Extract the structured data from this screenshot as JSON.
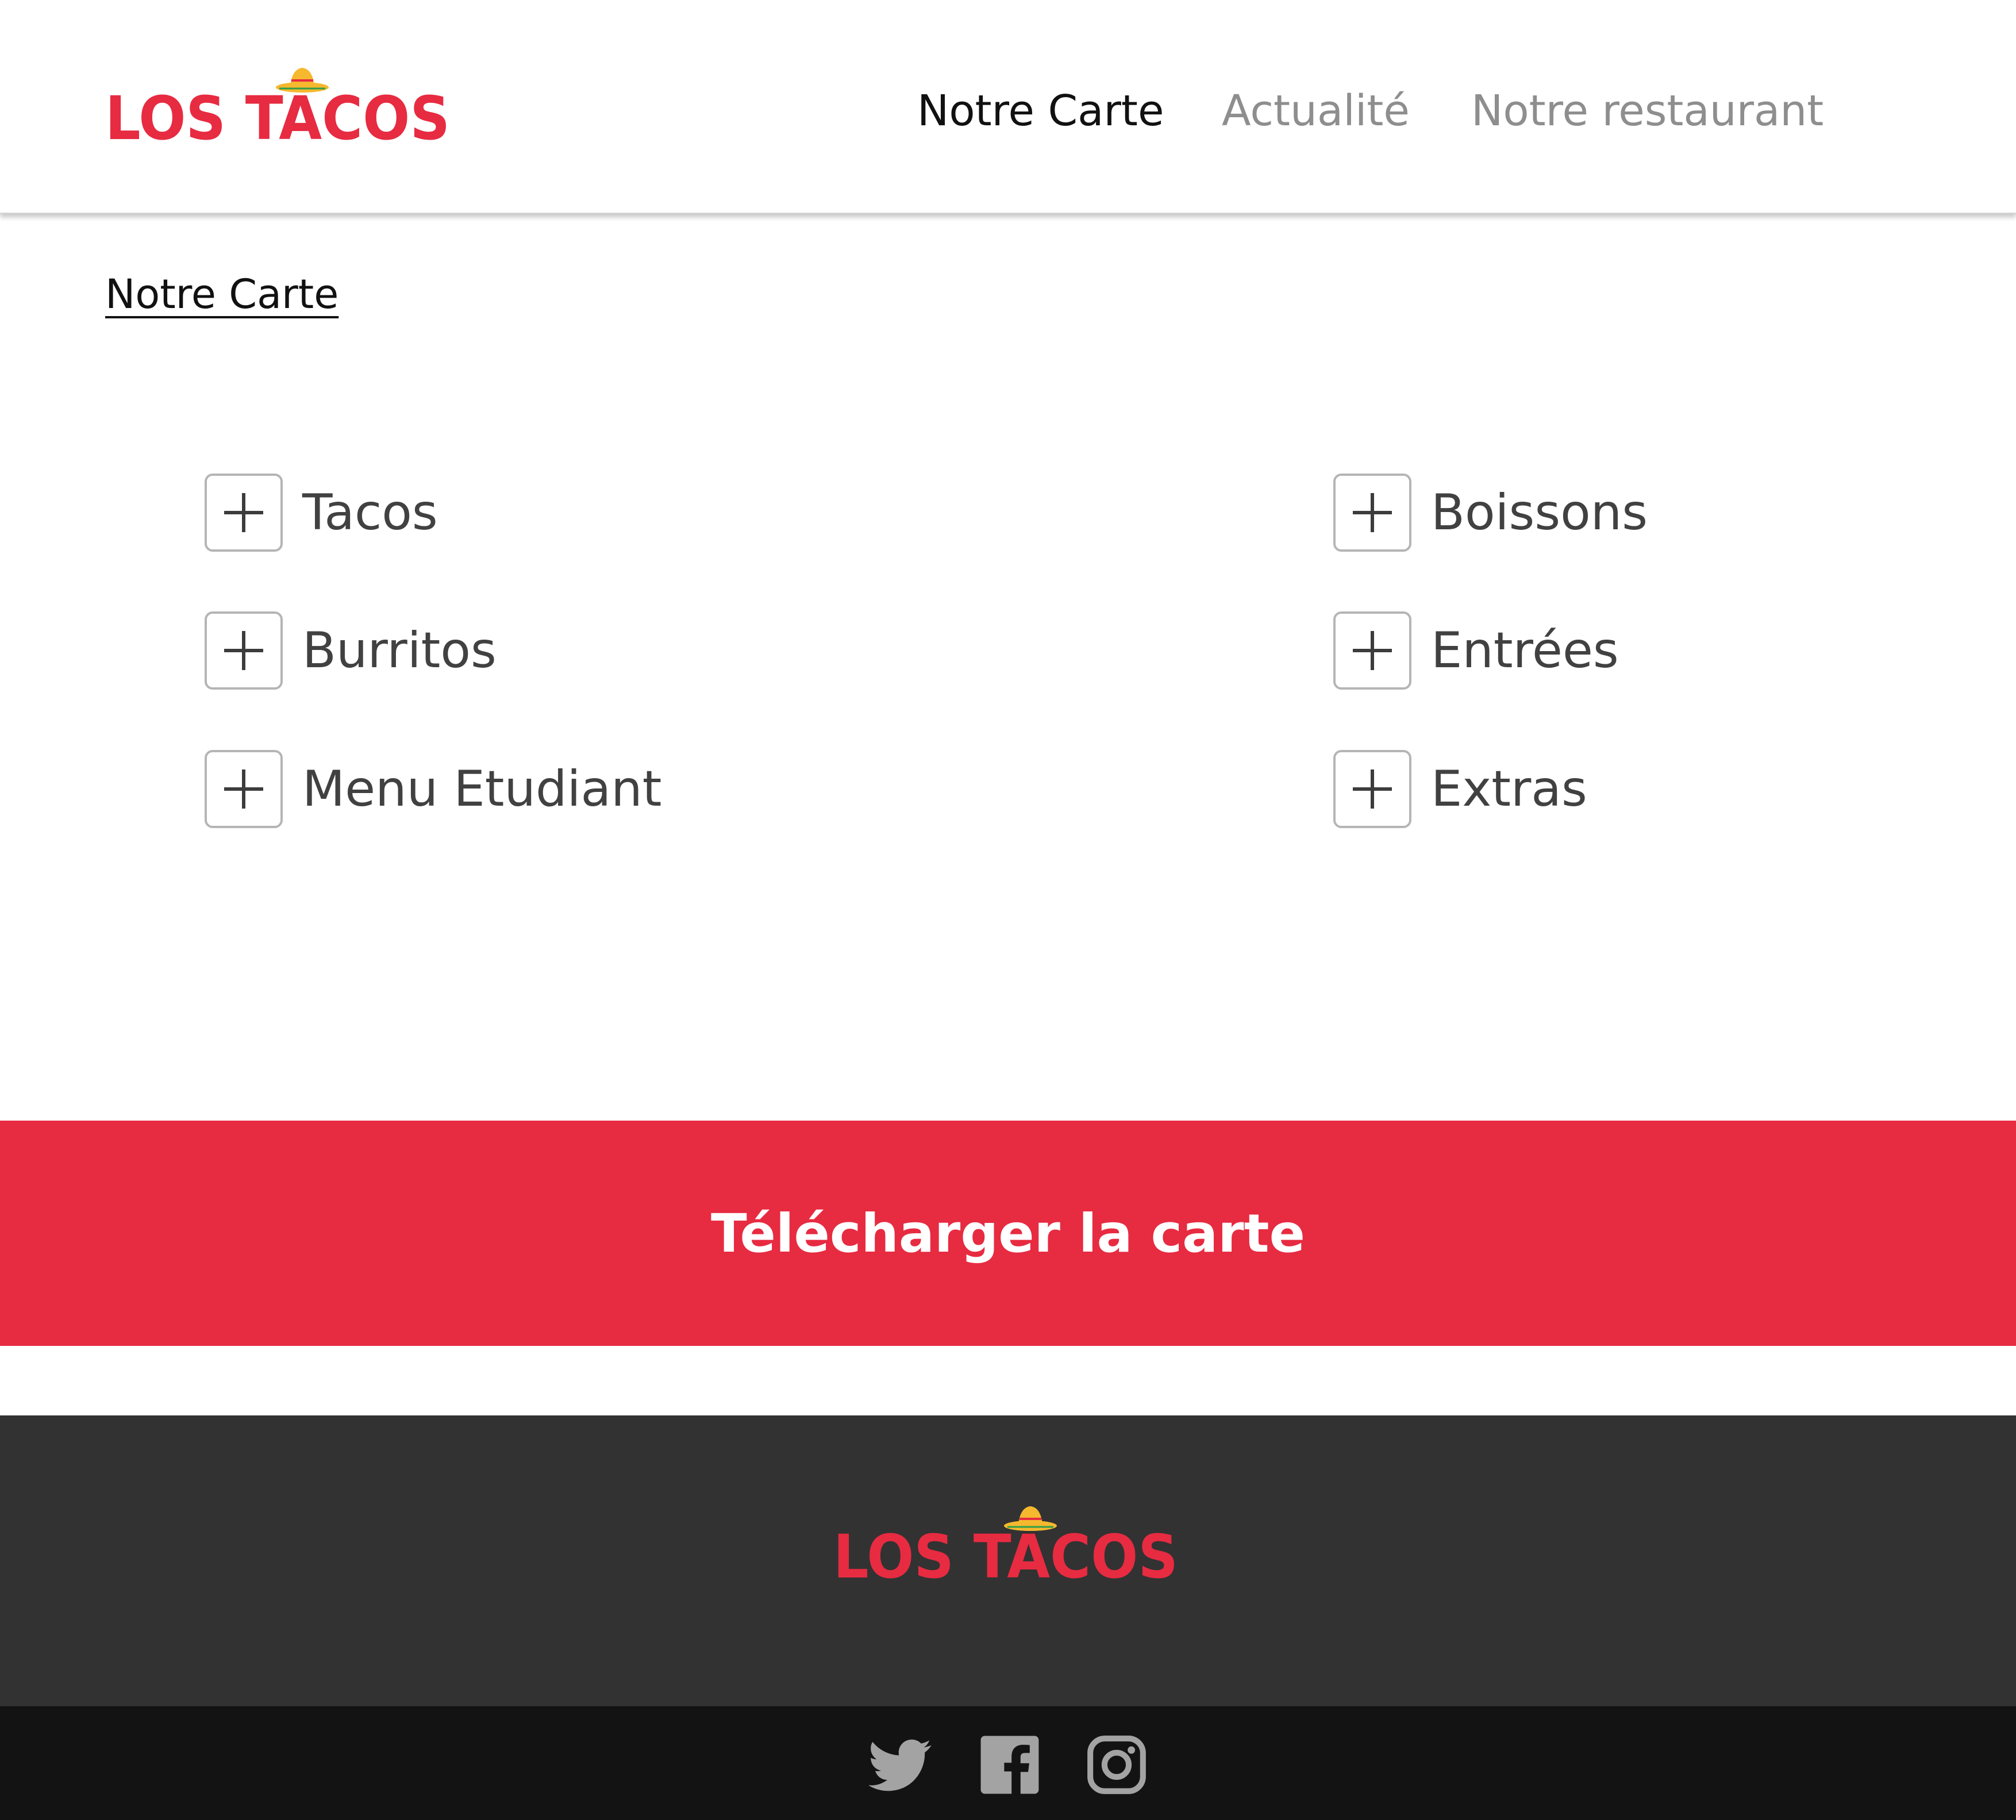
{
  "brand": {
    "name": "LOS TACOS",
    "color": "#e72b41",
    "accent_color": "#f5b82e"
  },
  "header": {
    "nav": [
      {
        "label": "Notre Carte",
        "active": true
      },
      {
        "label": "Actualité",
        "active": false
      },
      {
        "label": "Notre restaurant",
        "active": false
      }
    ]
  },
  "breadcrumb": {
    "label": "Notre Carte"
  },
  "menu": {
    "categories": [
      {
        "label": "Tacos",
        "icon": "plus-icon"
      },
      {
        "label": "Burritos",
        "icon": "plus-icon"
      },
      {
        "label": "Menu Etudiant",
        "icon": "plus-icon"
      },
      {
        "label": "Boissons",
        "icon": "plus-icon"
      },
      {
        "label": "Entrées",
        "icon": "plus-icon"
      },
      {
        "label": "Extras",
        "icon": "plus-icon"
      }
    ]
  },
  "download": {
    "label": "Télécharger la carte",
    "background_color": "#e72b41"
  },
  "footer": {
    "background_color": "#323232",
    "social_bar_color": "#131313",
    "social": [
      {
        "name": "twitter",
        "icon": "twitter-icon"
      },
      {
        "name": "facebook",
        "icon": "facebook-icon"
      },
      {
        "name": "instagram",
        "icon": "instagram-icon"
      }
    ]
  }
}
